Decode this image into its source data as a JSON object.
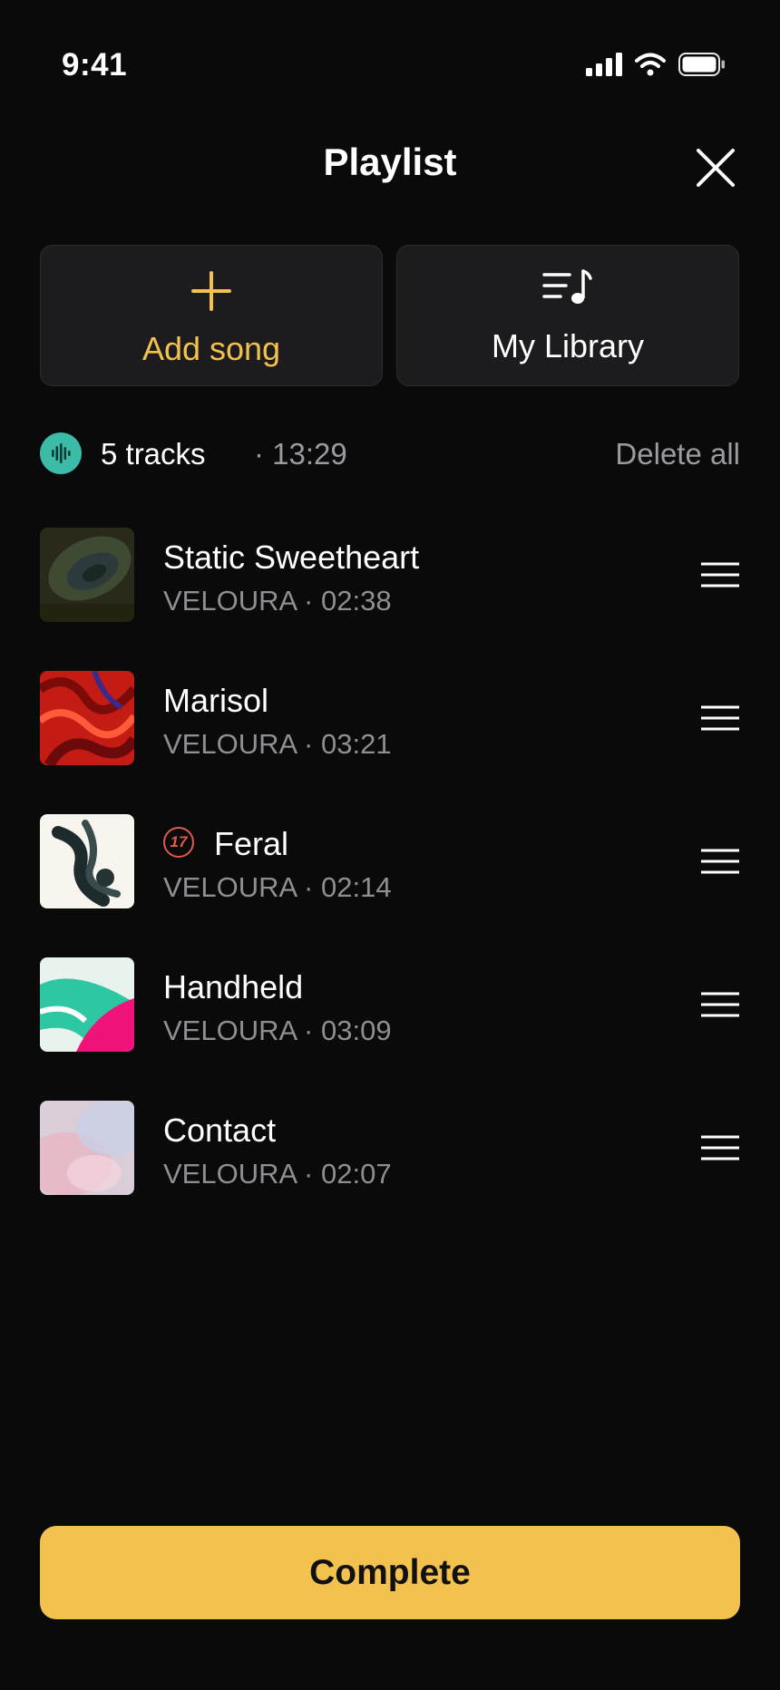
{
  "status_bar": {
    "time": "9:41"
  },
  "header": {
    "title": "Playlist"
  },
  "actions": {
    "add_song": "Add song",
    "my_library": "My Library"
  },
  "summary": {
    "tracks": "5 tracks",
    "duration": "· 13:29",
    "delete_all": "Delete all"
  },
  "tracks": [
    {
      "title": "Static Sweetheart",
      "subtitle": "VELOURA · 02:38"
    },
    {
      "title": "Marisol",
      "subtitle": "VELOURA · 03:21"
    },
    {
      "title": "Feral",
      "subtitle": "VELOURA · 02:14",
      "badge": "17"
    },
    {
      "title": "Handheld",
      "subtitle": "VELOURA · 03:09"
    },
    {
      "title": "Contact",
      "subtitle": "VELOURA · 02:07"
    }
  ],
  "footer": {
    "complete": "Complete"
  },
  "colors": {
    "accent": "#f2c14e",
    "badge": "#e05a4a",
    "teal": "#3dbba9",
    "background": "#0a0a0b"
  },
  "icons": [
    "signal-icon",
    "wifi-icon",
    "battery-icon",
    "close-icon",
    "plus-icon",
    "music-list-icon",
    "waveform-icon",
    "drag-handle-icon"
  ]
}
